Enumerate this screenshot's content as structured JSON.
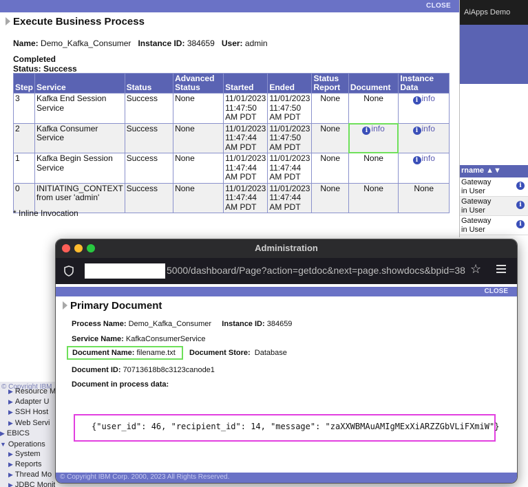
{
  "background_app": {
    "topbar_title": "AiApps Demo",
    "user_header": "rname ▲▼",
    "user_rows": [
      {
        "line1": "Gateway",
        "line2": "in User"
      },
      {
        "line1": "Gateway",
        "line2": "in User"
      },
      {
        "line1": "Gateway",
        "line2": "in User"
      }
    ],
    "left_copyright": "© Copyright IBM",
    "left_nav": [
      {
        "label": "Resource M",
        "indent": true
      },
      {
        "label": "Adapter U",
        "indent": true
      },
      {
        "label": "SSH Host",
        "indent": true
      },
      {
        "label": "Web Servi",
        "indent": true
      },
      {
        "label": "EBICS",
        "indent": false
      },
      {
        "label": "Operations",
        "indent": false
      },
      {
        "label": "System",
        "indent": true
      },
      {
        "label": "Reports",
        "indent": true
      },
      {
        "label": "Thread Mo",
        "indent": true
      },
      {
        "label": "JDBC Monitor",
        "indent": true
      }
    ]
  },
  "exec_panel": {
    "close_label": "CLOSE",
    "title": "Execute Business Process",
    "name_label": "Name:",
    "name_value": "Demo_Kafka_Consumer",
    "instance_label": "Instance ID:",
    "instance_value": "384659",
    "user_label": "User:",
    "user_value": "admin",
    "completed": "Completed",
    "status": "Status: Success",
    "columns": [
      "Step",
      "Service",
      "Status",
      "Advanced Status",
      "Started",
      "Ended",
      "Status Report",
      "Document",
      "Instance Data"
    ],
    "rows": [
      {
        "step": "3",
        "service": "Kafka End Session Service",
        "status": "Success",
        "adv_status": "None",
        "started": "11/01/2023 11:47:50 AM PDT",
        "ended": "11/01/2023 11:47:50 AM PDT",
        "status_report": "None",
        "document": "None",
        "instance_data": "info"
      },
      {
        "step": "2",
        "service": "Kafka Consumer Service",
        "status": "Success",
        "adv_status": "None",
        "started": "11/01/2023 11:47:44 AM PDT",
        "ended": "11/01/2023 11:47:50 AM PDT",
        "status_report": "None",
        "document": "info",
        "instance_data": "info"
      },
      {
        "step": "1",
        "service": "Kafka Begin Session Service",
        "status": "Success",
        "adv_status": "None",
        "started": "11/01/2023 11:47:44 AM PDT",
        "ended": "11/01/2023 11:47:44 AM PDT",
        "status_report": "None",
        "document": "None",
        "instance_data": "info"
      },
      {
        "step": "0",
        "service": "INITIATING_CONTEXT from user 'admin'",
        "status": "Success",
        "adv_status": "None",
        "started": "11/01/2023 11:47:44 AM PDT",
        "ended": "11/01/2023 11:47:44 AM PDT",
        "status_report": "None",
        "document": "None",
        "instance_data": "None"
      }
    ],
    "footnote": "* Inline Invocation"
  },
  "admin_window": {
    "title": "Administration",
    "url": "5000/dashboard/Page?action=getdoc&next=page.showdocs&bpid=38",
    "close_label": "CLOSE",
    "doc_title": "Primary Document",
    "process_name_label": "Process Name:",
    "process_name_value": "Demo_Kafka_Consumer",
    "instance_label": "Instance ID:",
    "instance_value": "384659",
    "service_name_label": "Service Name:",
    "service_name_value": "KafkaConsumerService",
    "doc_name_label": "Document Name:",
    "doc_name_value": "filename.txt",
    "doc_store_label": "Document Store:",
    "doc_store_value": "Database",
    "doc_id_label": "Document ID:",
    "doc_id_value": "70713618b8c3123canode1",
    "process_data_label": "Document in process data:",
    "process_data_value": "{\"user_id\": 46, \"recipient_id\": 14, \"message\": \"zaXXWBMAuAMIgMExXiARZZGbVLiFXmiW\"}",
    "footer": "© Copyright IBM Corp. 2000, 2023 All Rights Reserved."
  },
  "colors": {
    "header_blue": "#5a63b3",
    "close_bar": "#6a72c6",
    "highlight_green": "#6ee05a",
    "highlight_magenta": "#e23fe0"
  }
}
